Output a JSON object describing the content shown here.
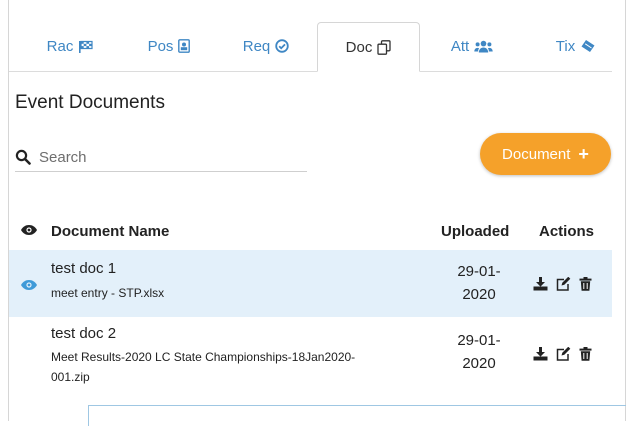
{
  "tabs": [
    {
      "label": "Rac",
      "icon": "flag-checkered-icon"
    },
    {
      "label": "Pos",
      "icon": "id-badge-icon"
    },
    {
      "label": "Req",
      "icon": "check-circle-icon"
    },
    {
      "label": "Doc",
      "icon": "copy-icon",
      "active": true
    },
    {
      "label": "Att",
      "icon": "users-icon"
    },
    {
      "label": "Tix",
      "icon": "ticket-icon"
    }
  ],
  "page": {
    "title": "Event Documents"
  },
  "search": {
    "placeholder": "Search",
    "value": ""
  },
  "add_button": {
    "label": "Document"
  },
  "table": {
    "headers": {
      "visible": "eye-icon",
      "name": "Document Name",
      "uploaded": "Uploaded",
      "actions": "Actions"
    },
    "rows": [
      {
        "name": "test doc 1",
        "file": "meet entry - STP.xlsx",
        "date_line1": "29-01-",
        "date_line2": "2020",
        "selected": true
      },
      {
        "name": "test doc 2",
        "file_line1": "Meet Results-2020 LC State Championships-18Jan2020-",
        "file_line2": "001.zip",
        "date_line1": "29-01-",
        "date_line2": "2020",
        "selected": false
      }
    ]
  },
  "colors": {
    "accent": "#f5a12a",
    "link": "#3f87c4",
    "row_highlight": "#e3f0fa"
  }
}
